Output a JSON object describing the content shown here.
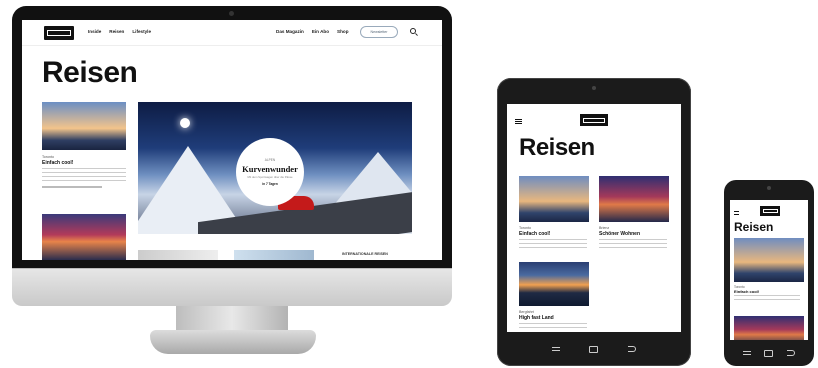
{
  "desktop": {
    "nav": {
      "links": [
        "Inside",
        "Reisen",
        "Lifestyle"
      ],
      "right_links": [
        "Das Magazin",
        "Ein Abo",
        "Shop"
      ],
      "subscribe_label": "Newsletter"
    },
    "page_title": "Reisen",
    "card1": {
      "kicker": "Toronto",
      "title": "Einfach cool!"
    },
    "hero": {
      "kicker": "ALPEN",
      "title": "Kurvenwunder",
      "subtitle": "Mit dem Sportwagen über die Pässe",
      "badge": "in 7 Tagen"
    },
    "side_heading": "INTERNATIONALE REISEN"
  },
  "tablet": {
    "page_title": "Reisen",
    "items": [
      {
        "kicker": "Toronto",
        "title": "Einfach cool!"
      },
      {
        "kicker": "Brienz",
        "title": "Schöner Wohnen"
      },
      {
        "kicker": "Bergfahrt",
        "title": "High fast Land"
      }
    ]
  },
  "phone": {
    "page_title": "Reisen",
    "item": {
      "kicker": "Toronto",
      "title": "Einfach cool!"
    }
  }
}
